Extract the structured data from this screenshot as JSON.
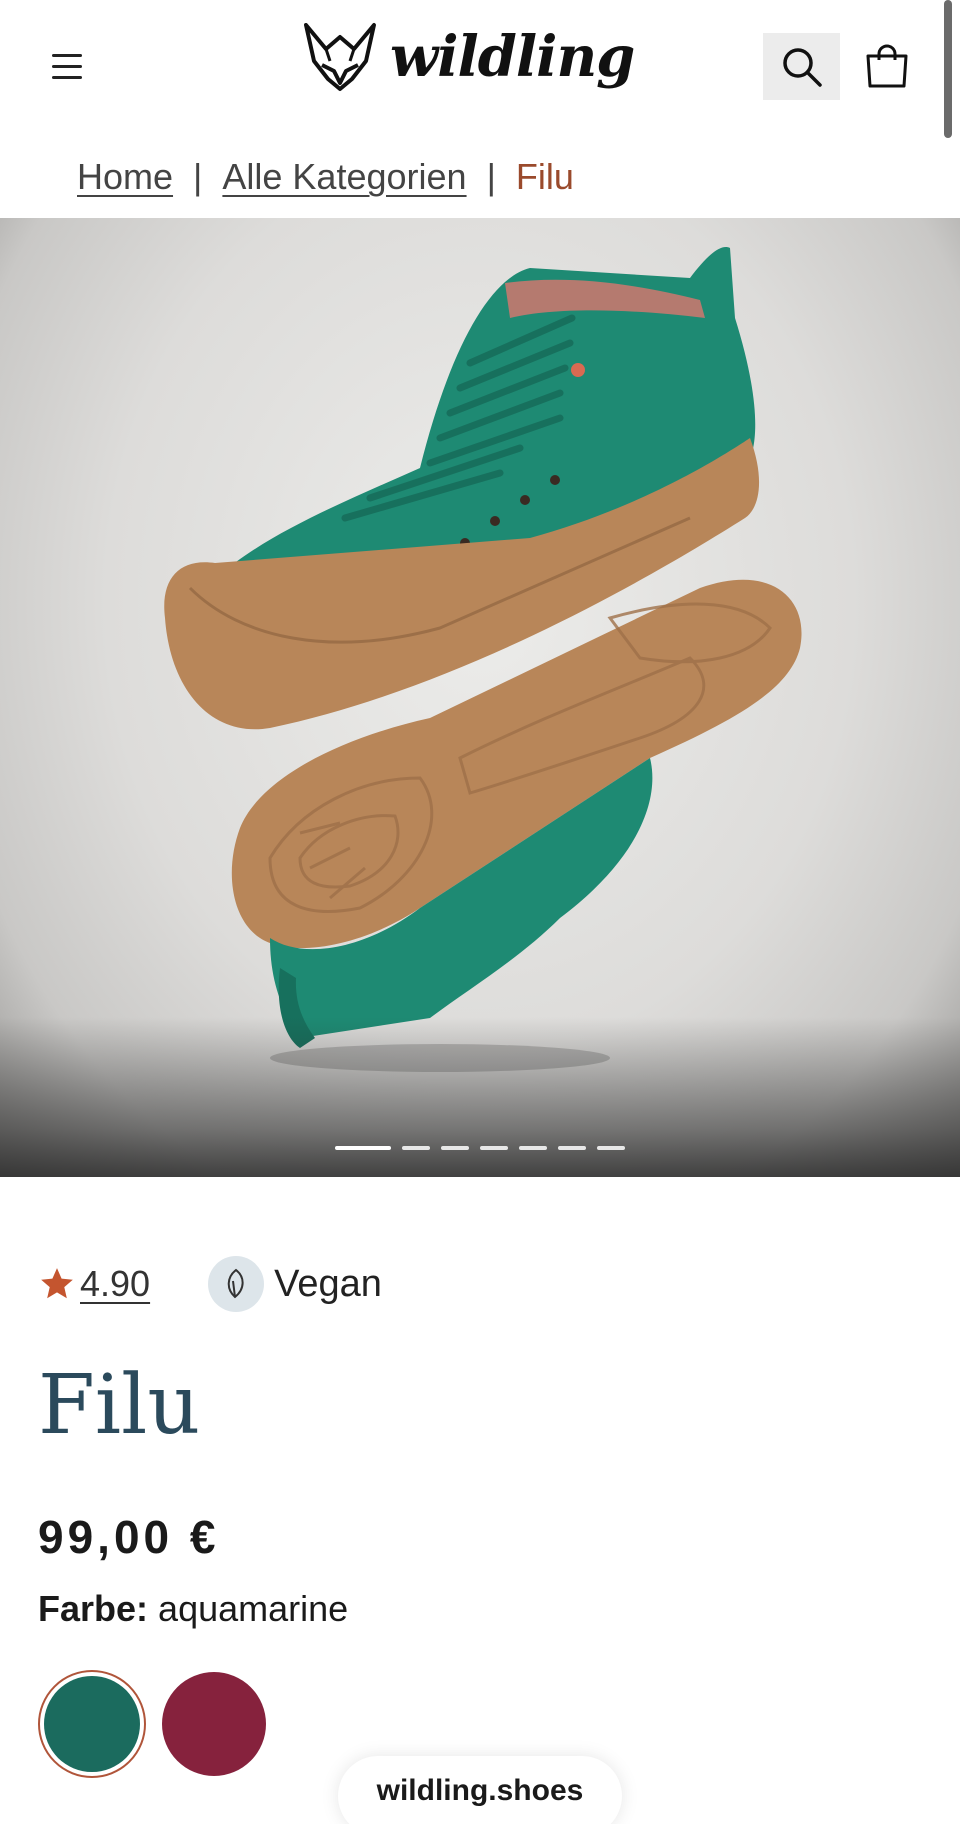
{
  "header": {
    "logo_text": "wildling",
    "menu_icon": "hamburger-menu-icon",
    "search_icon": "search-icon",
    "cart_icon": "shopping-bag-icon"
  },
  "breadcrumb": {
    "items": [
      {
        "label": "Home"
      },
      {
        "label": "Alle Kategorien"
      }
    ],
    "separator": "|",
    "current": "Filu"
  },
  "gallery": {
    "slide_count": 7,
    "active_index": 0
  },
  "product": {
    "rating": "4.90",
    "badge_label": "Vegan",
    "title": "Filu",
    "price": "99,00 €",
    "color_label": "Farbe:",
    "color_value": "aquamarine",
    "swatches": [
      {
        "color": "#1b6b5e",
        "selected": true
      },
      {
        "color": "#86223d",
        "selected": false
      }
    ]
  },
  "browser": {
    "url": "wildling.shoes"
  },
  "colors": {
    "accent": "#9a4a2c",
    "star": "#c4552f",
    "title": "#2b4a5c",
    "shoe_green": "#1e8a73",
    "sole": "#b88659"
  }
}
